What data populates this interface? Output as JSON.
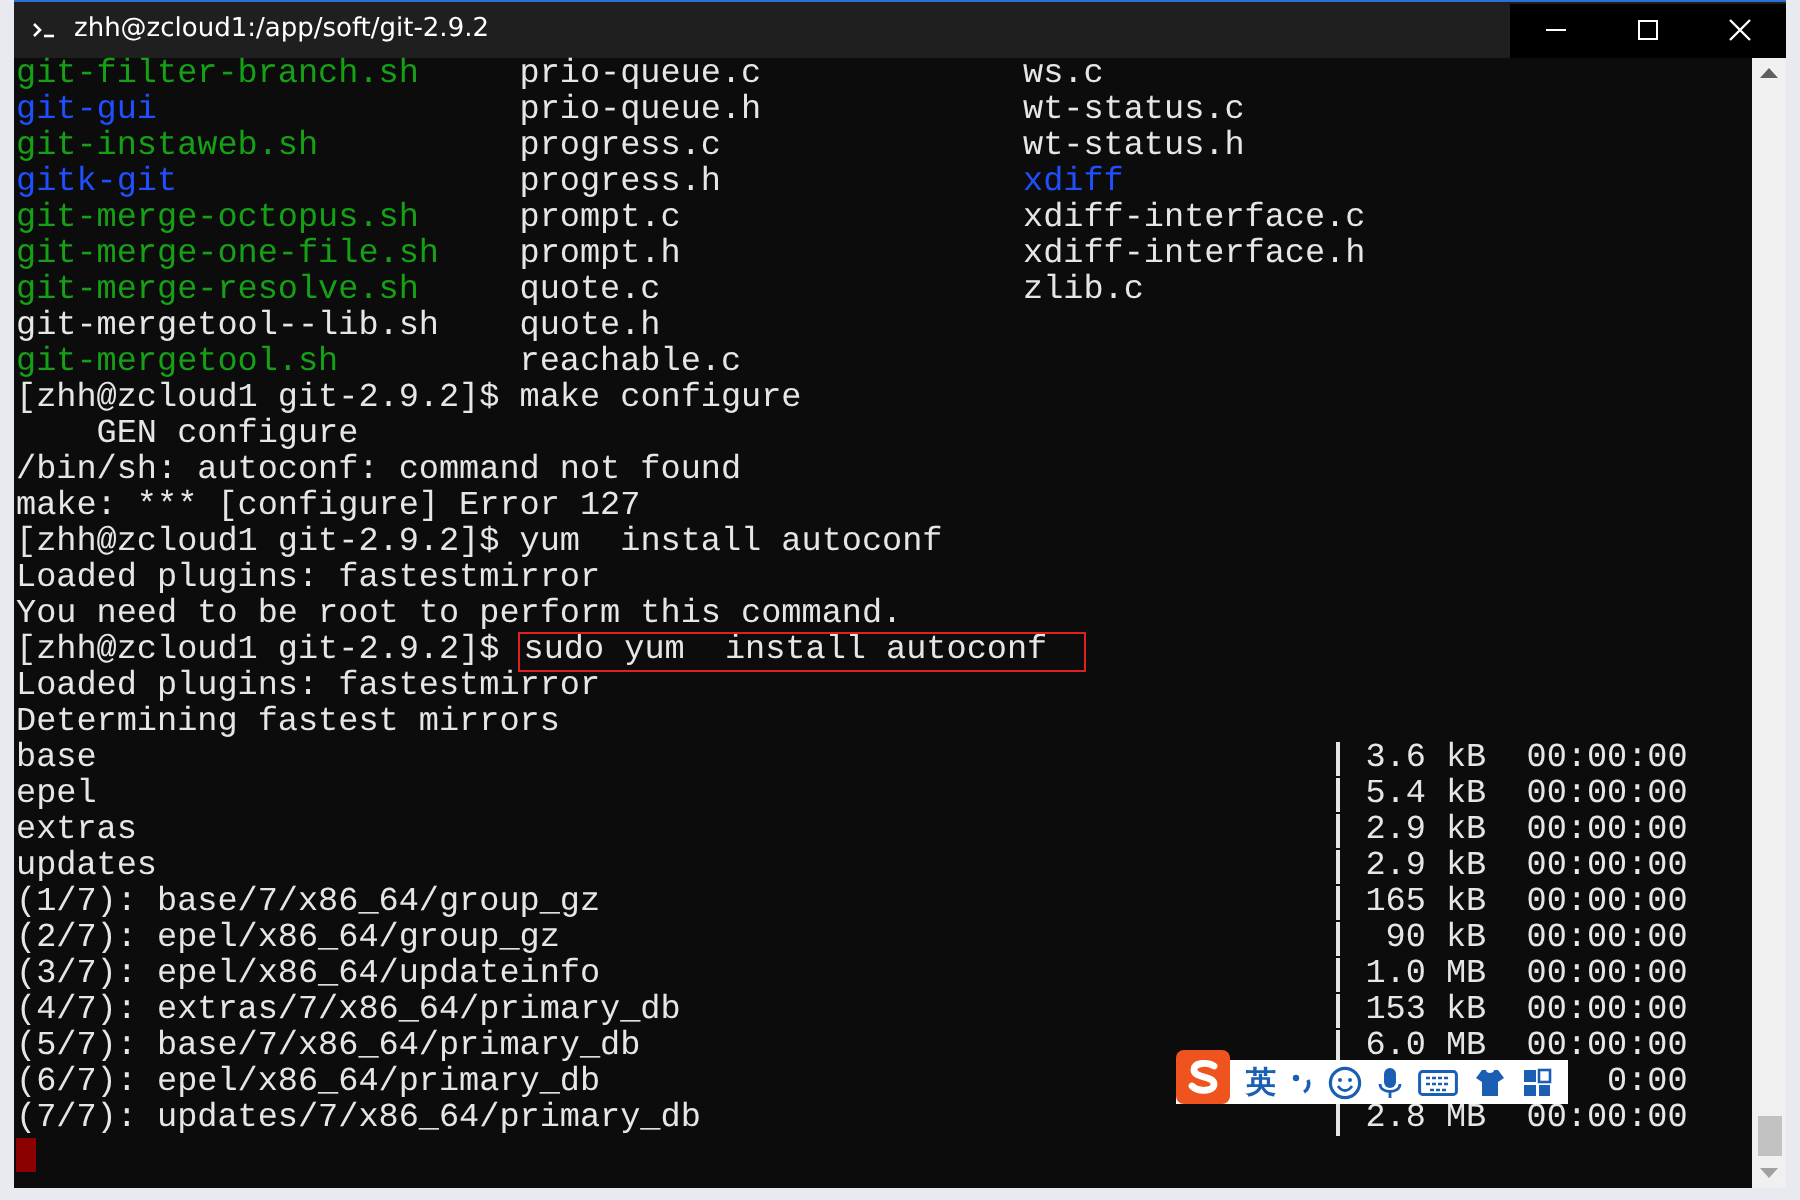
{
  "window": {
    "title": "zhh@zcloud1:/app/soft/git-2.9.2"
  },
  "listing": [
    [
      {
        "name": "git-filter-branch.sh",
        "kind": "executable"
      },
      {
        "name": "prio-queue.c",
        "kind": "file"
      },
      {
        "name": "ws.c",
        "kind": "file"
      }
    ],
    [
      {
        "name": "git-gui",
        "kind": "directory"
      },
      {
        "name": "prio-queue.h",
        "kind": "file"
      },
      {
        "name": "wt-status.c",
        "kind": "file"
      }
    ],
    [
      {
        "name": "git-instaweb.sh",
        "kind": "executable"
      },
      {
        "name": "progress.c",
        "kind": "file"
      },
      {
        "name": "wt-status.h",
        "kind": "file"
      }
    ],
    [
      {
        "name": "gitk-git",
        "kind": "directory"
      },
      {
        "name": "progress.h",
        "kind": "file"
      },
      {
        "name": "xdiff",
        "kind": "directory"
      }
    ],
    [
      {
        "name": "git-merge-octopus.sh",
        "kind": "executable"
      },
      {
        "name": "prompt.c",
        "kind": "file"
      },
      {
        "name": "xdiff-interface.c",
        "kind": "file"
      }
    ],
    [
      {
        "name": "git-merge-one-file.sh",
        "kind": "executable"
      },
      {
        "name": "prompt.h",
        "kind": "file"
      },
      {
        "name": "xdiff-interface.h",
        "kind": "file"
      }
    ],
    [
      {
        "name": "git-merge-resolve.sh",
        "kind": "executable"
      },
      {
        "name": "quote.c",
        "kind": "file"
      },
      {
        "name": "zlib.c",
        "kind": "file"
      }
    ],
    [
      {
        "name": "git-mergetool--lib.sh",
        "kind": "file"
      },
      {
        "name": "quote.h",
        "kind": "file"
      }
    ],
    [
      {
        "name": "git-mergetool.sh",
        "kind": "executable"
      },
      {
        "name": "reachable.c",
        "kind": "file"
      }
    ]
  ],
  "lines": [
    {
      "kind": "command",
      "prompt": "[zhh@zcloud1 git-2.9.2]$",
      "command": "make configure",
      "highlighted": false
    },
    {
      "kind": "output",
      "text": "    GEN configure"
    },
    {
      "kind": "output",
      "text": "/bin/sh: autoconf: command not found"
    },
    {
      "kind": "output",
      "text": "make: *** [configure] Error 127"
    },
    {
      "kind": "command",
      "prompt": "[zhh@zcloud1 git-2.9.2]$",
      "command": "yum  install autoconf",
      "highlighted": false
    },
    {
      "kind": "output",
      "text": "Loaded plugins: fastestmirror"
    },
    {
      "kind": "output",
      "text": "You need to be root to perform this command."
    },
    {
      "kind": "command",
      "prompt": "[zhh@zcloud1 git-2.9.2]$",
      "command": "sudo yum  install autoconf",
      "highlighted": true
    },
    {
      "kind": "output",
      "text": "Loaded plugins: fastestmirror"
    },
    {
      "kind": "output",
      "text": "Determining fastest mirrors"
    },
    {
      "kind": "transfer",
      "name": "base",
      "size": "3.6 kB",
      "time": "00:00:00"
    },
    {
      "kind": "transfer",
      "name": "epel",
      "size": "5.4 kB",
      "time": "00:00:00"
    },
    {
      "kind": "transfer",
      "name": "extras",
      "size": "2.9 kB",
      "time": "00:00:00"
    },
    {
      "kind": "transfer",
      "name": "updates",
      "size": "2.9 kB",
      "time": "00:00:00"
    },
    {
      "kind": "transfer",
      "name": "(1/7): base/7/x86_64/group_gz",
      "size": "165 kB",
      "time": "00:00:00"
    },
    {
      "kind": "transfer",
      "name": "(2/7): epel/x86_64/group_gz",
      "size": "90 kB",
      "time": "00:00:00"
    },
    {
      "kind": "transfer",
      "name": "(3/7): epel/x86_64/updateinfo",
      "size": "1.0 MB",
      "time": "00:00:00"
    },
    {
      "kind": "transfer",
      "name": "(4/7): extras/7/x86_64/primary_db",
      "size": "153 kB",
      "time": "00:00:00"
    },
    {
      "kind": "transfer",
      "name": "(5/7): base/7/x86_64/primary_db",
      "size": "6.0 MB",
      "time": "00:00:00"
    },
    {
      "kind": "transfer",
      "name": "(6/7): epel/x86_64/primary_db",
      "time": "0:00"
    },
    {
      "kind": "transfer",
      "name": "(7/7): updates/7/x86_64/primary_db",
      "size": "2.8 MB",
      "time": "00:00:00"
    },
    {
      "kind": "cursor"
    }
  ],
  "ime_toolbar": {
    "mode": "英"
  }
}
